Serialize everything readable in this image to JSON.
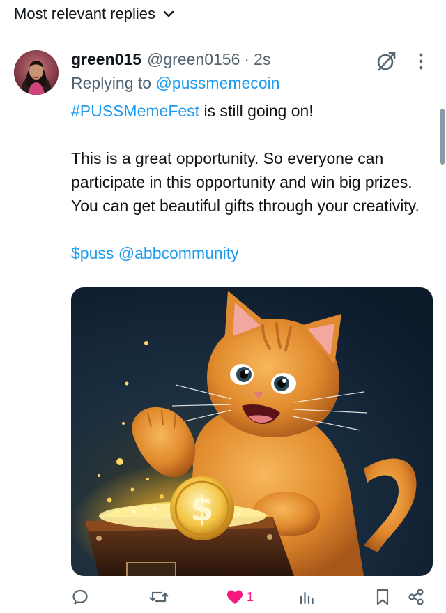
{
  "header": {
    "sort_label": "Most relevant replies"
  },
  "reply": {
    "author_name": "green015",
    "author_handle": "@green0156",
    "separator": "·",
    "time": "2s",
    "replying_prefix": "Replying to",
    "replying_to": "@pussmemecoin",
    "hashtag": "#PUSSMemeFest",
    "line1_rest": " is still going on!",
    "paragraph2": "This is a great opportunity. So everyone can participate in this opportunity and win big prizes. You can get beautiful gifts through your creativity.",
    "cashtag": "$puss",
    "mention": "@abbcommunity",
    "like_count": "1"
  },
  "colors": {
    "link": "#1d9bf0",
    "text": "#0f1419",
    "muted": "#536471",
    "like": "#f91880"
  },
  "icons": {
    "sort": "chevron-down-icon",
    "grok": "grok-icon",
    "more": "more-vertical-icon",
    "reply": "reply-icon",
    "repost": "repost-icon",
    "like": "heart-filled-icon",
    "views": "views-icon",
    "bookmark": "bookmark-icon",
    "share": "share-icon"
  }
}
